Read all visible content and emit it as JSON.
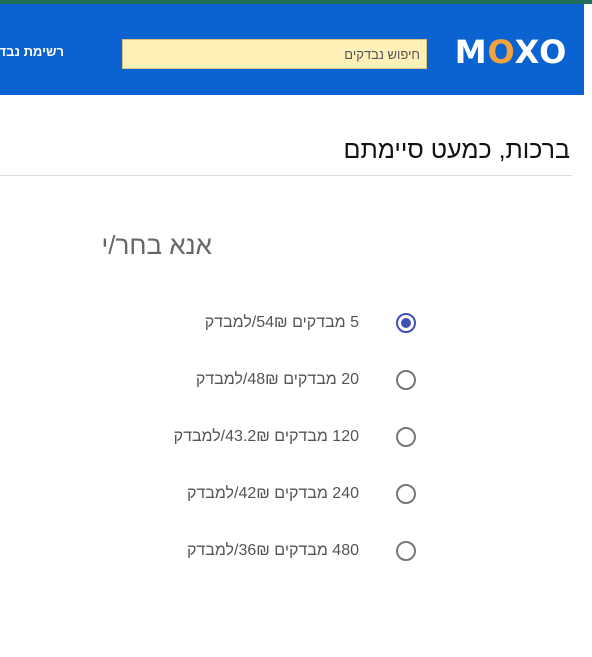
{
  "header": {
    "logo_text": "MOXO",
    "search": {
      "placeholder": "חיפוש נבדקים",
      "value": ""
    },
    "nav_title": "רשימת נבדקים"
  },
  "page": {
    "heading": "ברכות, כמעט סיימתם",
    "choose_title": "אנא בחר/י"
  },
  "options": [
    {
      "label": "5 מבדקים 54₪/למבדק",
      "selected": true
    },
    {
      "label": "20 מבדקים 48₪/למבדק",
      "selected": false
    },
    {
      "label": "120 מבדקים 43.2₪/למבדק",
      "selected": false
    },
    {
      "label": "240 מבדקים 42₪/למבדק",
      "selected": false
    },
    {
      "label": "480 מבדקים 36₪/למבדק",
      "selected": false
    }
  ],
  "colors": {
    "header_bg": "#0b63d1",
    "search_bg": "#fff0b8",
    "radio_selected": "#3f51b5",
    "logo_accent": "#f2a33a"
  }
}
